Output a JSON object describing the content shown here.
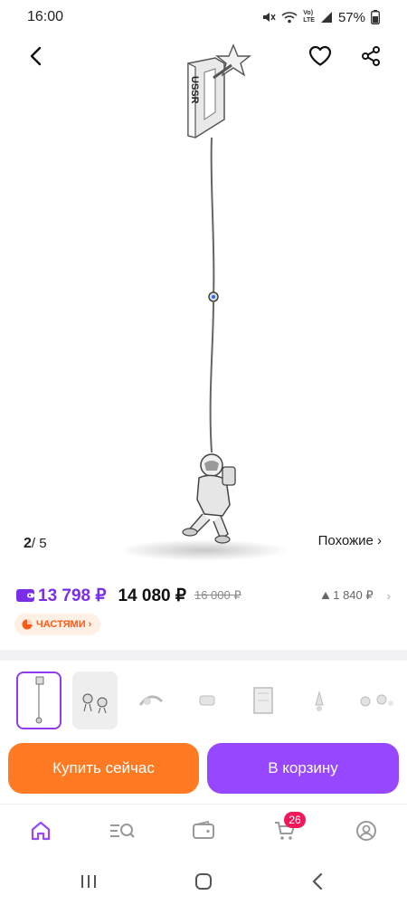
{
  "status_bar": {
    "time": "16:00",
    "battery": "57%",
    "net_label_top": "Vo)",
    "net_label_bottom": "LTE"
  },
  "gallery": {
    "current": "2",
    "total": "/ 5",
    "similar_label": "Похожие ›"
  },
  "engraving": "USSR",
  "price": {
    "wallet_price": "13 798 ₽",
    "price": "14 080 ₽",
    "old_price": "16 000 ₽",
    "bonus": "1 840 ₽",
    "bonus_chevron": "›"
  },
  "installments_badge": "ЧАСТЯМИ ›",
  "thumbnails": [
    {
      "name": "thumb-earring-chain",
      "active": true
    },
    {
      "name": "thumb-earring-pair",
      "active": false
    },
    {
      "name": "thumb-detail-1",
      "active": false
    },
    {
      "name": "thumb-detail-2",
      "active": false
    },
    {
      "name": "thumb-detail-3",
      "active": false
    },
    {
      "name": "thumb-detail-4",
      "active": false
    },
    {
      "name": "thumb-detail-5",
      "active": false
    }
  ],
  "actions": {
    "buy_now": "Купить сейчас",
    "add_to_cart": "В корзину"
  },
  "bottom_nav": {
    "cart_count": "26"
  },
  "colors": {
    "accent_purple": "#9747ff",
    "accent_orange": "#ff7a22",
    "badge_pink": "#f0185a"
  },
  "icons": [
    "back-arrow-icon",
    "heart-icon",
    "share-icon",
    "wallet-icon",
    "pie-icon",
    "home-icon",
    "catalog-search-icon",
    "wallet-nav-icon",
    "cart-icon",
    "profile-icon"
  ]
}
